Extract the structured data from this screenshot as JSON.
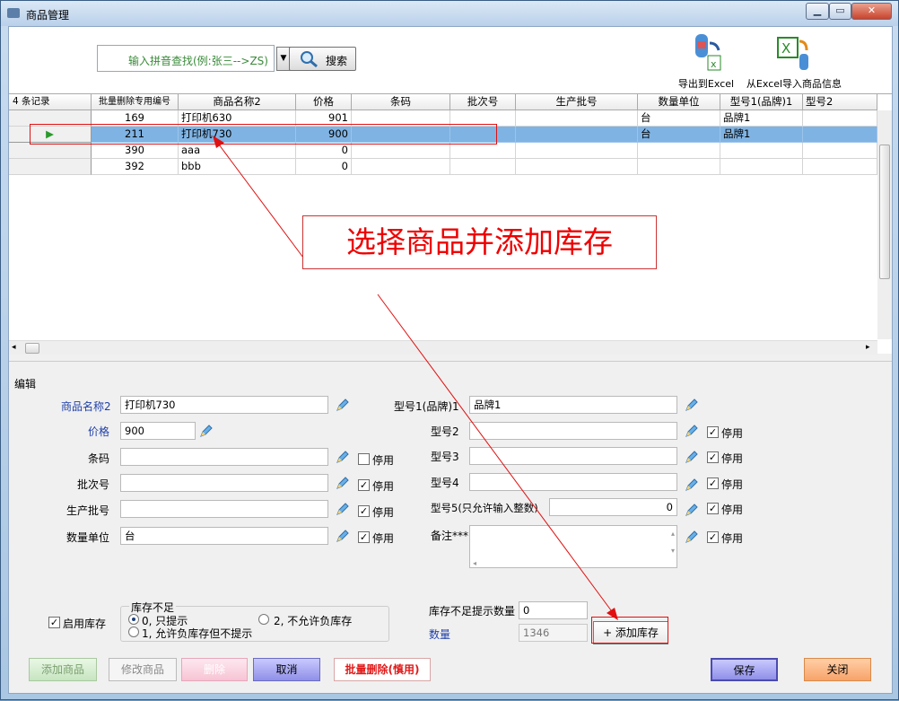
{
  "window": {
    "title": "商品管理",
    "min": "▁",
    "max": "▭",
    "close": "✕"
  },
  "toolbar": {
    "search_placeholder": "输入拼音查找(例:张三-->ZS)",
    "search_label": "搜索",
    "export_label": "导出到Excel",
    "import_label": "从Excel导入商品信息"
  },
  "grid": {
    "record_count": "4 条记录",
    "columns": [
      "批量删除专用编号",
      "商品名称2",
      "价格",
      "条码",
      "批次号",
      "生产批号",
      "数量单位",
      "型号1(品牌)1",
      "型号2"
    ],
    "rows": [
      {
        "id": "169",
        "name": "打印机630",
        "price": "901",
        "unit": "台",
        "brand": "品牌1"
      },
      {
        "id": "211",
        "name": "打印机730",
        "price": "900",
        "unit": "台",
        "brand": "品牌1"
      },
      {
        "id": "390",
        "name": "aaa",
        "price": "0",
        "unit": "",
        "brand": ""
      },
      {
        "id": "392",
        "name": "bbb",
        "price": "0",
        "unit": "",
        "brand": ""
      }
    ],
    "selected_marker": "▶"
  },
  "annotation": "选择商品并添加库存",
  "edit": {
    "group_label": "编辑",
    "name_label": "商品名称2",
    "name_value": "打印机730",
    "price_label": "价格",
    "price_value": "900",
    "barcode_label": "条码",
    "batch_label": "批次号",
    "prod_batch_label": "生产批号",
    "unit_label": "数量单位",
    "unit_value": "台",
    "model1_label": "型号1(品牌)1",
    "model1_value": "品牌1",
    "model2_label": "型号2",
    "model3_label": "型号3",
    "model4_label": "型号4",
    "model5_label": "型号5(只允许输入整数)",
    "model5_value": "0",
    "remark_label": "备注***",
    "disable_label": "停用",
    "enable_stock_label": "启用库存",
    "check": "✓",
    "shortage_group": "库存不足",
    "opt0": "0, 只提示",
    "opt1": "1, 允许负库存但不提示",
    "opt2": "2, 不允许负库存",
    "shortage_qty_label": "库存不足提示数量",
    "shortage_qty_value": "0",
    "qty_label": "数量",
    "qty_value": "1346",
    "add_stock_label": "+ 添加库存"
  },
  "buttons": {
    "add": "添加商品",
    "modify": "修改商品",
    "delete": "删除",
    "cancel": "取消",
    "batch_delete": "批量删除(慎用)",
    "save": "保存",
    "close": "关闭"
  }
}
